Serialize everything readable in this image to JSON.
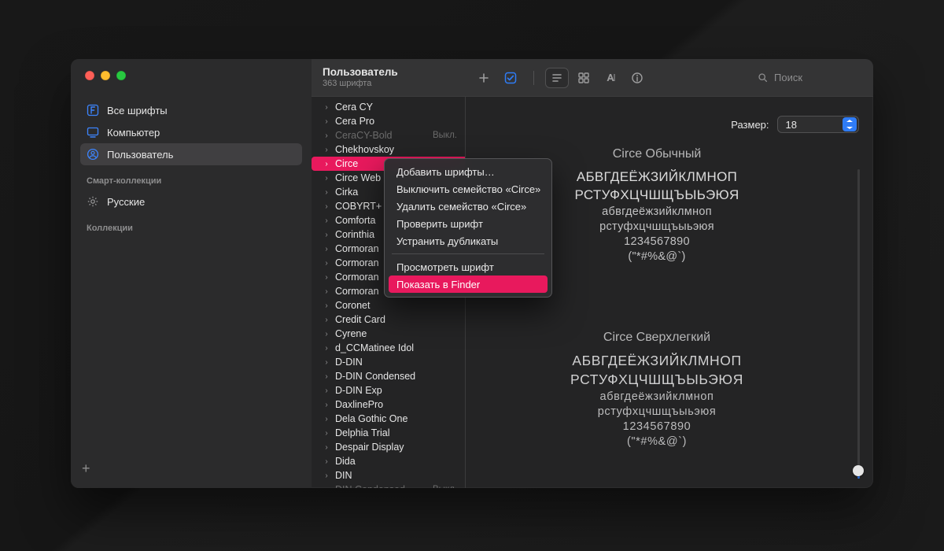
{
  "header": {
    "title": "Пользователь",
    "subtitle": "363 шрифта",
    "search_placeholder": "Поиск"
  },
  "traffic_colors": {
    "close": "#ff5f57",
    "min": "#ffbd2e",
    "max": "#28c940"
  },
  "sidebar": {
    "sources": [
      {
        "id": "all",
        "label": "Все шрифты"
      },
      {
        "id": "comp",
        "label": "Компьютер"
      },
      {
        "id": "user",
        "label": "Пользователь",
        "selected": true
      }
    ],
    "smart_section_label": "Смарт-коллекции",
    "smart": [
      {
        "id": "russian",
        "label": "Русские"
      }
    ],
    "collections_section_label": "Коллекции"
  },
  "font_list": {
    "selected_index": 4,
    "items": [
      {
        "name": "Cera CY"
      },
      {
        "name": "Cera Pro"
      },
      {
        "name": "CeraCY-Bold",
        "off": true,
        "suffix": "Выкл."
      },
      {
        "name": "Chekhovskoy"
      },
      {
        "name": "Circe",
        "selected": true
      },
      {
        "name": "Circe Web"
      },
      {
        "name": "Cirka"
      },
      {
        "name": "COBYRT+"
      },
      {
        "name": "Comforta"
      },
      {
        "name": "Corinthia"
      },
      {
        "name": "Cormoran"
      },
      {
        "name": "Cormoran"
      },
      {
        "name": "Cormoran"
      },
      {
        "name": "Cormoran"
      },
      {
        "name": "Coronet"
      },
      {
        "name": "Credit Card"
      },
      {
        "name": "Cyrene"
      },
      {
        "name": "d_CCMatinee Idol"
      },
      {
        "name": "D-DIN"
      },
      {
        "name": "D-DIN Condensed"
      },
      {
        "name": "D-DIN Exp"
      },
      {
        "name": "DaxlinePro"
      },
      {
        "name": "Dela Gothic One"
      },
      {
        "name": "Delphia Trial"
      },
      {
        "name": "Despair Display"
      },
      {
        "name": "Dida"
      },
      {
        "name": "DIN"
      },
      {
        "name": "DIN Condensed",
        "off": true,
        "suffix": "Выкл."
      }
    ]
  },
  "context_menu": {
    "items": [
      {
        "label": "Добавить шрифты…"
      },
      {
        "label": "Выключить семейство «Circe»"
      },
      {
        "label": "Удалить семейство «Circe»"
      },
      {
        "label": "Проверить шрифт"
      },
      {
        "label": "Устранить дубликаты"
      },
      {
        "sep": true
      },
      {
        "label": "Просмотреть шрифт"
      },
      {
        "label": "Показать в Finder",
        "hover": true
      }
    ]
  },
  "preview": {
    "size_label": "Размер:",
    "size_value": "18",
    "samples": [
      {
        "title": "Circe Обычный",
        "lines_upper": [
          "АБВГДЕЁЖЗИЙКЛМНОП",
          "РСТУФХЦЧШЩЪЫЬЭЮЯ"
        ],
        "lines_lower": [
          "абвгдеёжзийклмноп",
          "рстуфхцчшщъыьэюя"
        ],
        "digits": "1234567890",
        "symbols": "(\"*#%&@`)"
      },
      {
        "title": "Circe Сверхлегкий",
        "lines_upper": [
          "АБВГДЕЁЖЗИЙКЛМНОП",
          "РСТУФХЦЧШЩЪЫЬЭЮЯ"
        ],
        "lines_lower": [
          "абвгдеёжзийклмноп",
          "рстуфхцчшщъыьэюя"
        ],
        "digits": "1234567890",
        "symbols": "(\"*#%&@`)"
      }
    ]
  }
}
